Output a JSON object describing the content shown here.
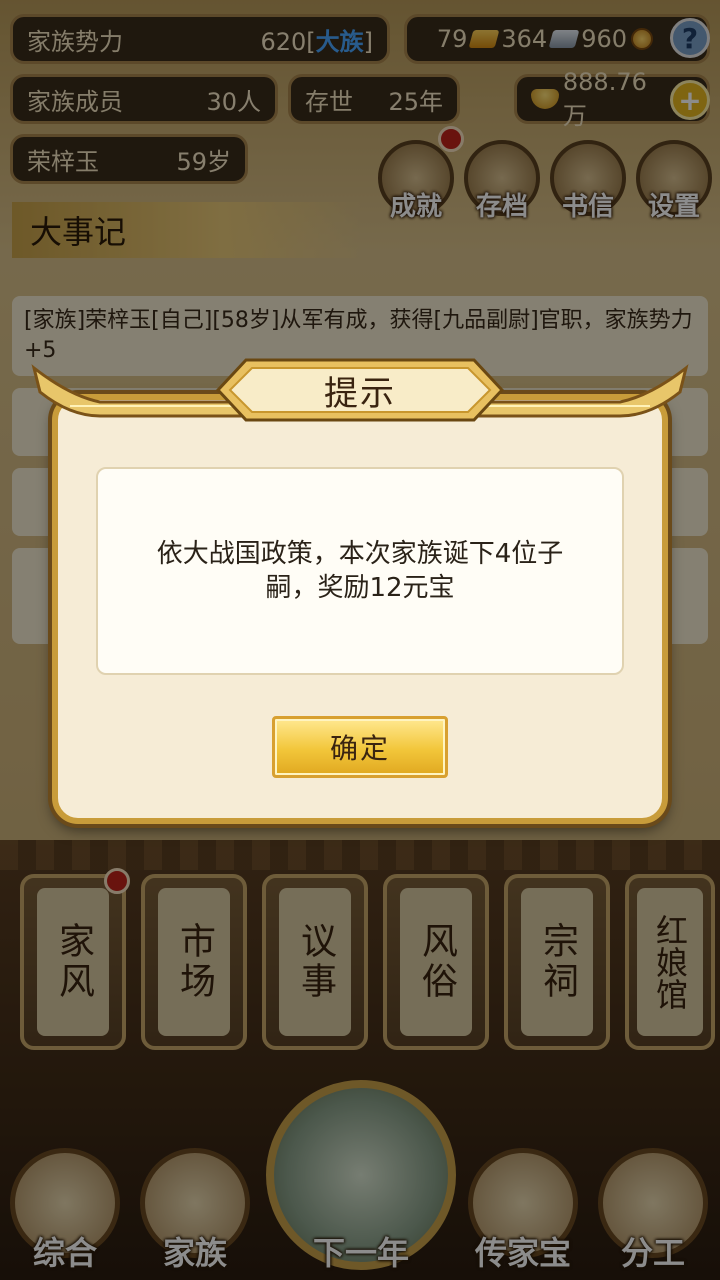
{
  "stats": {
    "power_label": "家族势力",
    "power_value": "620",
    "power_tag": "大族",
    "members_label": "家族成员",
    "members_value": "30人",
    "exist_label": "存世",
    "exist_value": "25年",
    "leader_name": "荣梓玉",
    "leader_age": "59岁"
  },
  "resources": {
    "gold": "79",
    "silver": "364",
    "coins": "960",
    "ingots": "888.76万",
    "help_symbol": "?",
    "plus_symbol": "+"
  },
  "menu": {
    "achievements": "成就",
    "save": "存档",
    "letters": "书信",
    "settings": "设置"
  },
  "records": {
    "header": "大事记",
    "items": [
      "[家族]荣梓玉[自己][58岁]从军有成，获得[九品副尉]官职，家族势力+5"
    ]
  },
  "buildings": [
    "家风",
    "市场",
    "议事",
    "风俗",
    "宗祠",
    "红娘馆"
  ],
  "nav": {
    "overview": "综合",
    "family": "家族",
    "next_year": "下一年",
    "heirloom": "传家宝",
    "assign": "分工"
  },
  "dialog": {
    "title": "提示",
    "message": "依大战国政策，本次家族诞下4位子嗣，奖励12元宝",
    "confirm_label": "确定"
  },
  "colors": {
    "dialog_bg": "#f6ecd6",
    "dialog_border": "#c89c3a",
    "button_gold": "#f2c63a",
    "tag_blue": "#4aa6ff"
  }
}
